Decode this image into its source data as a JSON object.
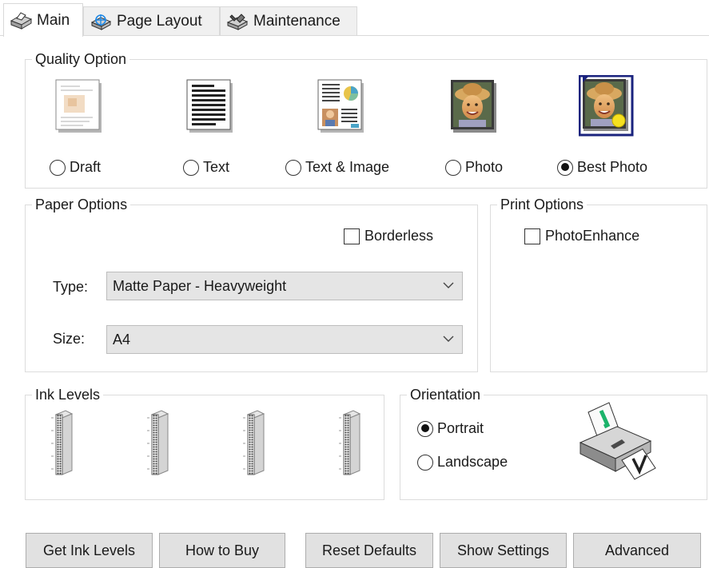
{
  "tabs": [
    {
      "label": "Main",
      "icon": "printer-tab-icon"
    },
    {
      "label": "Page Layout",
      "icon": "page-layout-icon"
    },
    {
      "label": "Maintenance",
      "icon": "maintenance-icon"
    }
  ],
  "quality": {
    "legend": "Quality Option",
    "options": [
      {
        "label": "Draft",
        "icon": "draft-document-icon",
        "selected": false
      },
      {
        "label": "Text",
        "icon": "text-document-icon",
        "selected": false
      },
      {
        "label": "Text & Image",
        "icon": "text-image-document-icon",
        "selected": false
      },
      {
        "label": "Photo",
        "icon": "photo-icon",
        "selected": false
      },
      {
        "label": "Best Photo",
        "icon": "best-photo-icon",
        "selected": true
      }
    ]
  },
  "paper": {
    "legend": "Paper Options",
    "borderless_label": "Borderless",
    "borderless_checked": false,
    "type_label": "Type:",
    "type_value": "Matte Paper - Heavyweight",
    "size_label": "Size:",
    "size_value": "A4"
  },
  "print_options": {
    "legend": "Print Options",
    "photoenhance_label": "PhotoEnhance",
    "photoenhance_checked": false
  },
  "ink": {
    "legend": "Ink Levels",
    "cartridges": 4
  },
  "orientation": {
    "legend": "Orientation",
    "portrait_label": "Portrait",
    "landscape_label": "Landscape",
    "selected": "portrait"
  },
  "buttons": {
    "get_ink_levels": "Get Ink Levels",
    "how_to_buy": "How to Buy",
    "reset_defaults": "Reset Defaults",
    "show_settings": "Show Settings",
    "advanced": "Advanced"
  },
  "colors": {
    "selected_border": "#1a237e",
    "group_border": "#dcdcdc",
    "button_bg": "#e1e1e1"
  }
}
